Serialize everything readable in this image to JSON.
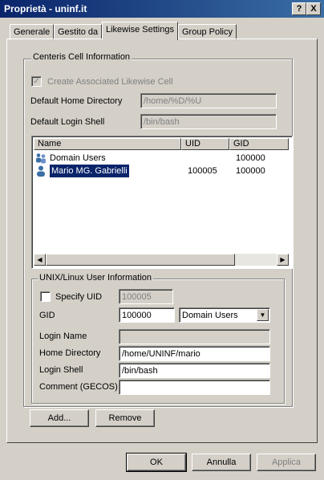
{
  "window": {
    "title": "Proprietà - uninf.it",
    "help_btn": "?",
    "close_btn": "X"
  },
  "tabs": [
    "Generale",
    "Gestito da",
    "Likewise Settings",
    "Group Policy"
  ],
  "cell_info": {
    "legend": "Centeris Cell Information",
    "create_assoc_label": "Create Associated Likewise Cell",
    "create_assoc_checked": true,
    "home_dir_label": "Default Home Directory",
    "home_dir_value": "/home/%D/%U",
    "login_shell_label": "Default Login Shell",
    "login_shell_value": "/bin/bash"
  },
  "user_list": {
    "columns": [
      "Name",
      "UID",
      "GID"
    ],
    "rows": [
      {
        "name": "Domain Users",
        "uid": "",
        "gid": "100000",
        "icon": "group-icon"
      },
      {
        "name": "Mario MG. Gabrielli",
        "uid": "100005",
        "gid": "100000",
        "icon": "user-icon",
        "selected": true
      }
    ]
  },
  "unix_info": {
    "legend": "UNIX/Linux User Information",
    "specify_uid_label": "Specify UID",
    "uid_value": "100005",
    "gid_label": "GID",
    "gid_value": "100000",
    "gid_group": "Domain Users",
    "login_name_label": "Login Name",
    "login_name_value": "",
    "home_dir_label": "Home Directory",
    "home_dir_value": "/home/UNINF/mario",
    "login_shell_label": "Login Shell",
    "login_shell_value": "/bin/bash",
    "comment_label": "Comment (GECOS)",
    "comment_value": ""
  },
  "actions": {
    "add": "Add...",
    "remove": "Remove"
  },
  "footer": {
    "ok": "OK",
    "cancel": "Annulla",
    "apply": "Applica"
  }
}
